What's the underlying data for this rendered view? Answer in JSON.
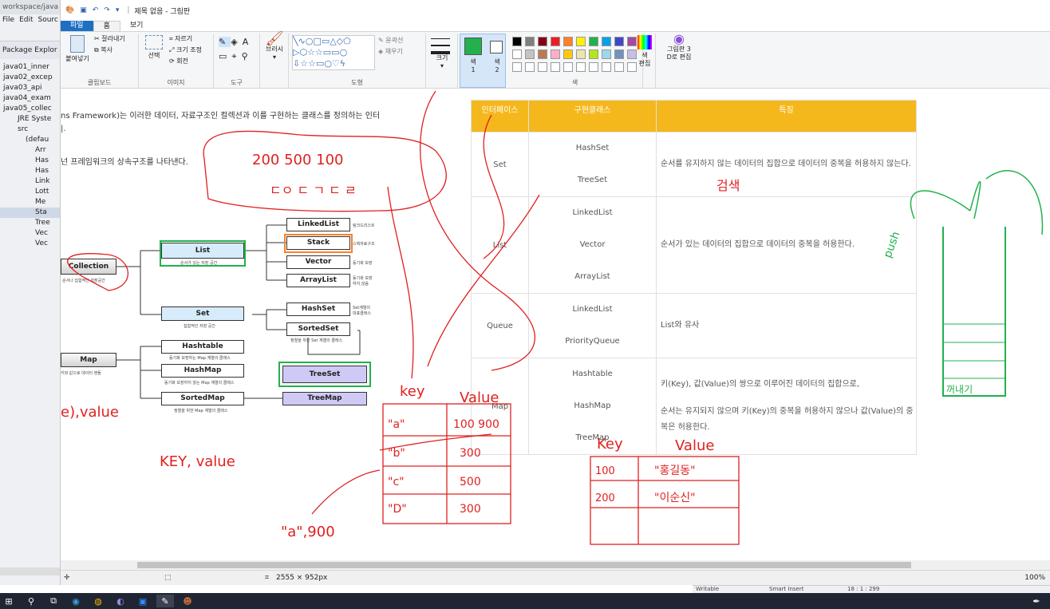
{
  "eclipse": {
    "title": "workspace/java",
    "menu": [
      "File",
      "Edit",
      "Sourc"
    ],
    "explorer_title": "Package Explor",
    "tree": [
      "java01_inner",
      "java02_excep",
      "java03_api",
      "java04_exam",
      "java05_collec",
      "JRE Syste",
      "src",
      "(defau",
      "Arr",
      "Has",
      "Has",
      "Link",
      "Lott",
      "Me",
      "Sta",
      "Tree",
      "Vec",
      "Vec"
    ],
    "bottom_status": [
      "Writable",
      "Smart Insert",
      "18 : 1 : 299"
    ]
  },
  "paint": {
    "title": "제목 없음 - 그림판",
    "tabs": {
      "file": "파일",
      "home": "홈",
      "view": "보기"
    },
    "clipboard": {
      "paste": "붙여넣기",
      "cut": "잘라내기",
      "copy": "복사",
      "label": "클립보드"
    },
    "image": {
      "select": "선택",
      "crop": "자르기",
      "resize": "크기 조정",
      "rotate": "회전",
      "label": "이미지"
    },
    "tools_label": "도구",
    "brushes": "브러시",
    "shapes": {
      "outline": "윤곽선",
      "fill": "채우기",
      "label": "도형"
    },
    "size": "크기",
    "color1": "색\n1",
    "color1_label": "색",
    "color1_num": "1",
    "color2_label": "색",
    "color2_num": "2",
    "colors_label": "색",
    "edit_colors": "색\n편집",
    "edit_colors_a": "색",
    "edit_colors_b": "편집",
    "paint3d_a": "그림판 3",
    "paint3d_b": "D로 편집",
    "palette": [
      "#000000",
      "#7f7f7f",
      "#880015",
      "#ed1c24",
      "#ff7f27",
      "#fff200",
      "#22b14c",
      "#00a2e8",
      "#3f48cc",
      "#a349a4",
      "#ffffff",
      "#c3c3c3",
      "#b97a57",
      "#ffaec9",
      "#ffc90e",
      "#efe4b0",
      "#b5e61d",
      "#99d9ea",
      "#7092be",
      "#c8bfe7"
    ],
    "status": {
      "size": "2555 × 952px",
      "zoom": "100%"
    }
  },
  "canvas": {
    "intro_line1": "ns Framework)는 이러한 데이터, 자료구조인 컬렉션과 이를 구현하는 클래스를 정의하는 인터",
    "intro_line1b": "터",
    "intro_line2": "|.",
    "intro_line3": "넌 프레임워크의 상속구조를 나타낸다.",
    "diagram": {
      "collection": "Collection",
      "collection_cap": "순서나 집합적인 저장공간",
      "list": "List",
      "list_cap": "순서가 있는 저장 공간",
      "set": "Set",
      "set_cap": "집합적인 저장 공간",
      "map": "Map",
      "map_cap": "키와 값으로 데이터 핸들",
      "linkedlist": "LinkedList",
      "linkedlist_cap": "링크드리스트",
      "stack": "Stack",
      "stack_cap": "스택자료구조",
      "vector": "Vector",
      "vector_cap": "동기화 보장",
      "arraylist": "ArrayList",
      "arraylist_cap1": "동기화 보장",
      "arraylist_cap2": "하지 않음",
      "hashset": "HashSet",
      "hashset_cap1": "Set계열의",
      "hashset_cap2": "대표클래스",
      "sortedset": "SortedSet",
      "sortedset_cap": "정렬을 위한 Set 계열의 클래스",
      "treeset": "TreeSet",
      "hashtable": "Hashtable",
      "hashtable_cap": "동기화 보장하는 Map 계열의 클래스",
      "hashmap": "HashMap",
      "hashmap_cap": "동기화 보장하지 않는 Map 계열의 클래스",
      "sortedmap": "SortedMap",
      "sortedmap_cap": "정렬을 위한 Map 계열의 클래스",
      "treemap": "TreeMap"
    },
    "table": {
      "headers": [
        "인터페이스",
        "구현클래스",
        "특징"
      ],
      "rows": [
        {
          "iface": "Set",
          "impl": [
            "HashSet",
            "TreeSet"
          ],
          "feat": "순서를 유지하지 않는 데이터의 집합으로 데이터의 중복을 허용하지 않는다."
        },
        {
          "iface": "List",
          "impl": [
            "LinkedList",
            "Vector",
            "ArrayList"
          ],
          "feat": "순서가 있는 데이터의 집합으로 데이터의 중복을 허용한다."
        },
        {
          "iface": "Queue",
          "impl": [
            "LinkedList",
            "PriorityQueue"
          ],
          "feat": "List와 유사"
        },
        {
          "iface": "Map",
          "impl": [
            "Hashtable",
            "HashMap",
            "TreeMap"
          ],
          "feat": "키(Key), 값(Value)의 쌍으로 이루어진 데이터의 집합으로,",
          "feat2": "순서는 유지되지 않으며 키(Key)의 중복을 허용하지 않으나 값(Value)의 중복은 허용한다."
        }
      ]
    },
    "handwriting": {
      "top_values": "200 500 100",
      "top_letters": "ㄷㅇ ㄷ ㄱ ㄷ ㄹ",
      "key_value_left": "e),value",
      "key_value_mid": "KEY, value",
      "a_900": "\"a\",900",
      "key1": "key",
      "value1": "Value",
      "grid1": [
        "\"a\"",
        "100 900",
        "\"b\"",
        "300",
        "\"c\"",
        "500",
        "\"D\"",
        "300"
      ],
      "key2": "Key",
      "value2": "Value",
      "grid2": [
        "100",
        "\"홍길동\"",
        "200",
        "\"이순신\""
      ],
      "korean_note": "검색",
      "push": "push",
      "pop_note": "꺼내기"
    }
  }
}
